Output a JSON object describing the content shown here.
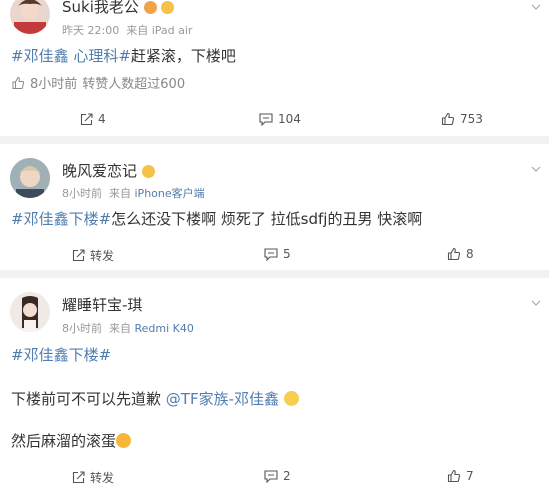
{
  "posts": [
    {
      "user_name": "Suki我老公",
      "timestamp": "昨天 22:00",
      "source_prefix": "来自",
      "source": "iPad air",
      "tag": "#邓佳鑫 心理科#",
      "text": "赶紧滚，下楼吧",
      "sub_time": "8小时前",
      "sub_text": "转赞人数超过600",
      "repost_count": "4",
      "comment_count": "104",
      "like_count": "753"
    },
    {
      "user_name": "晚风爱恋记",
      "timestamp": "8小时前",
      "source_prefix": "来自",
      "source": "iPhone客户端",
      "tag": "#邓佳鑫下楼#",
      "text": "怎么还没下楼啊 烦死了 拉低sdfj的丑男 快滚啊",
      "repost_label": "转发",
      "comment_count": "5",
      "like_count": "8"
    },
    {
      "user_name": "耀睡轩宝-琪",
      "timestamp": "8小时前",
      "source_prefix": "来自",
      "source": "Redmi K40",
      "tag": "#邓佳鑫下楼#",
      "line2": "下楼前可不可以先道歉",
      "mention": "@TF家族-邓佳鑫",
      "line3": "然后麻溜的滚蛋",
      "repost_label": "转发",
      "comment_count": "2",
      "like_count": "7"
    }
  ],
  "colors": {
    "link": "#507daf",
    "meta": "#999999",
    "text": "#333333",
    "separator": "#f2f2f2"
  },
  "icons": [
    "chevron-down-icon",
    "repost-icon",
    "comment-icon",
    "like-icon",
    "emoji-icon"
  ]
}
